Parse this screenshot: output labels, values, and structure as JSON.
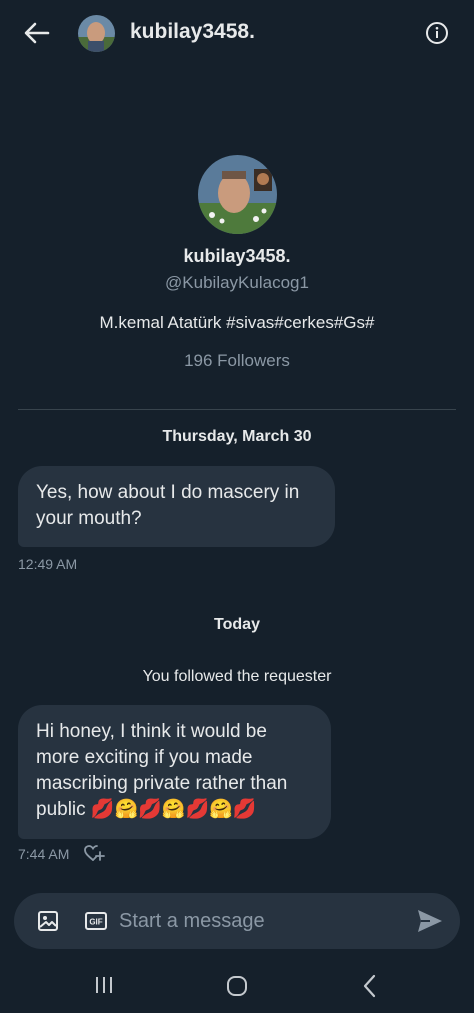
{
  "header": {
    "username": "kubilay3458."
  },
  "profile": {
    "display_name": "kubilay3458.",
    "handle": "@KubilayKulacog1",
    "bio": "M.kemal Atatürk #sivas#cerkes#Gs#",
    "followers": "196 Followers"
  },
  "conversation": {
    "date_1": "Thursday, March 30",
    "message_1": {
      "text": "Yes, how about I do mascery in your mouth?",
      "time": "12:49 AM"
    },
    "date_2": "Today",
    "system_note": "You followed the requester",
    "message_2": {
      "text": "Hi honey, I think it would be more exciting if you made mascribing private rather than public ",
      "emojis": "💋🤗💋🤗💋🤗💋",
      "time": "7:44 AM"
    }
  },
  "composer": {
    "placeholder": "Start a message"
  },
  "icons": {
    "back": "arrow-left-icon",
    "info": "info-icon",
    "media": "image-icon",
    "gif": "gif-icon",
    "send": "send-icon",
    "react": "heart-plus-icon"
  },
  "colors": {
    "background": "#15202b",
    "bubble": "#273340",
    "secondary_text": "#8b98a5",
    "divider": "#38444d"
  }
}
